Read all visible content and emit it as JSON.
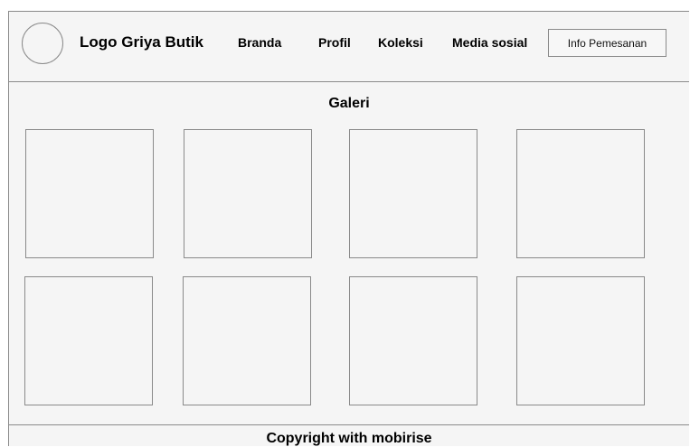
{
  "header": {
    "brand": "Logo Griya Butik",
    "nav": [
      "Branda",
      "Profil",
      "Koleksi",
      "Media sosial"
    ],
    "order_button": "Info Pemesanan"
  },
  "main": {
    "title": "Galeri",
    "gallery_count": 8
  },
  "footer": {
    "text": "Copyright with mobirise"
  }
}
